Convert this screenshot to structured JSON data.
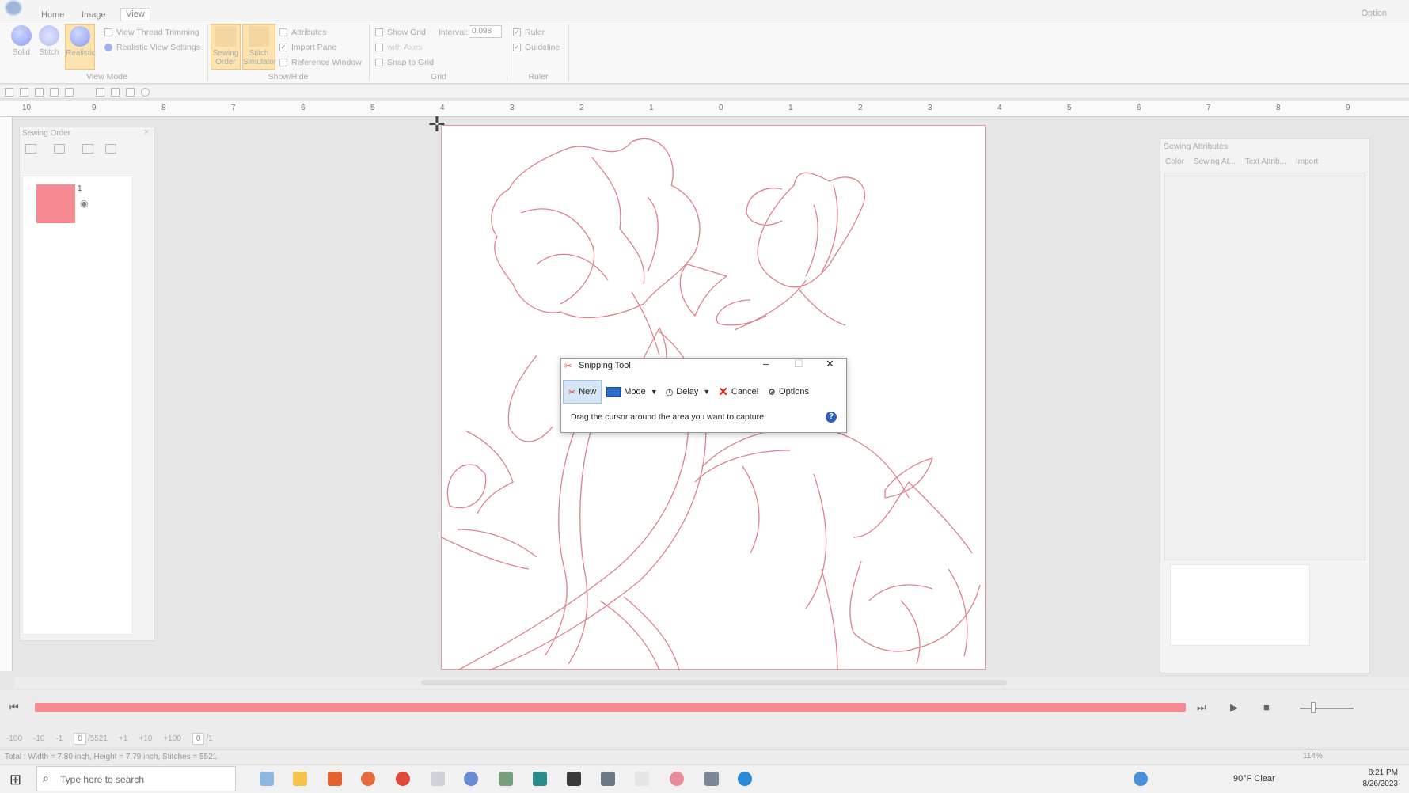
{
  "ribbon": {
    "tabs": [
      "Home",
      "Image",
      "View"
    ],
    "option_label": "Option",
    "view_mode": {
      "group_label": "View Mode",
      "solid": "Solid",
      "stitch": "Stitch",
      "realistic": "Realistic",
      "view_thread_trimming": "View Thread Trimming",
      "realistic_view_settings": "Realistic View Settings"
    },
    "show_hide": {
      "group_label": "Show/Hide",
      "sewing_order": "Sewing Order",
      "stitch_simulator": "Stitch Simulator",
      "attributes": "Attributes",
      "import_pane": "Import Pane",
      "reference_window": "Reference Window"
    },
    "grid": {
      "group_label": "Grid",
      "show_grid": "Show Grid",
      "interval_label": "Interval:",
      "interval_value": "0.098",
      "with_axes": "with Axes",
      "snap_to_grid": "Snap to Grid"
    },
    "ruler": {
      "group_label": "Ruler",
      "ruler": "Ruler",
      "guideline": "Guideline"
    }
  },
  "ruler_numbers": [
    "10",
    "9",
    "8",
    "7",
    "6",
    "5",
    "4",
    "3",
    "2",
    "1",
    "0",
    "1",
    "2",
    "3",
    "4",
    "5",
    "6",
    "7",
    "8",
    "9"
  ],
  "sewing_order": {
    "title": "Sewing Order",
    "item_number": "1",
    "swatch_color": "#f58a92"
  },
  "sewing_attributes": {
    "title": "Sewing Attributes",
    "tabs": [
      "Color",
      "Sewing At...",
      "Text Attrib...",
      "Import"
    ]
  },
  "snipping_tool": {
    "title": "Snipping Tool",
    "new_label": "New",
    "mode_label": "Mode",
    "delay_label": "Delay",
    "cancel_label": "Cancel",
    "options_label": "Options",
    "message": "Drag the cursor around the area you want to capture."
  },
  "simulator": {
    "stitch_field": "0",
    "stitch_total": "/5521",
    "step_1": "+1",
    "step_10": "+10",
    "step_100": "+100",
    "frame_field": "0",
    "frame_total": "/1",
    "minus_100": "-100",
    "minus_10": "-10",
    "minus_1": "-1"
  },
  "status": {
    "text": "Total : Width = 7.80 inch, Height = 7.79 inch, Stitches = 5521",
    "zoom": "114%"
  },
  "taskbar": {
    "search_placeholder": "Type here to search",
    "weather": "90°F  Clear",
    "time": "8:21 PM",
    "date": "8/26/2023"
  },
  "colors": {
    "accent": "#f58a92",
    "outline": "#d9848c"
  }
}
